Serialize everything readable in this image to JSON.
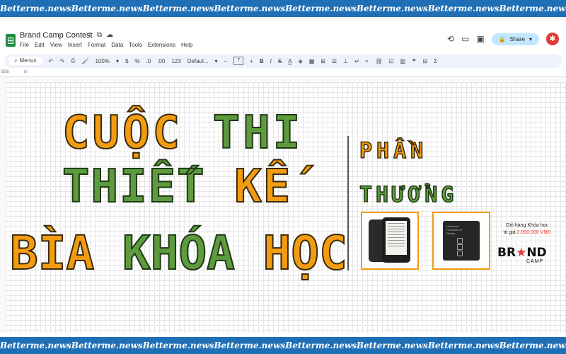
{
  "watermark": {
    "text": "Betterme.news",
    "repeat": 9,
    "band_color": "#1f6fb6"
  },
  "app": {
    "title": "Brand Camp Contest",
    "menu": [
      "File",
      "Edit",
      "View",
      "Insert",
      "Format",
      "Data",
      "Tools",
      "Extensions",
      "Help"
    ],
    "share_label": "Share",
    "toolbar": {
      "menus_label": "Menus",
      "zoom": "100%",
      "currency": "$",
      "percent": "%",
      "decimal_less": ".0",
      "decimal_more": ".00",
      "number_format": "123",
      "font": "Defaul...",
      "font_size": "7",
      "bold": "B",
      "italic": "I",
      "strike": "S",
      "text_color": "A"
    },
    "cell_ref": "B56",
    "fx": "fx"
  },
  "poster": {
    "line1": [
      "CUỘC",
      "THI"
    ],
    "line2": [
      "THIẾT",
      "KẾ"
    ],
    "line3": [
      "BÌA",
      "KHÓA",
      "HỌC"
    ],
    "prize_line1": "PHẦN",
    "prize_line2": "THƯỞNG",
    "course_text": "Giỏ hàng Khóa học",
    "course_value_prefix": "trị giá",
    "course_price": "2.000.000 VNĐ",
    "brand_left": "BR",
    "brand_star": "★",
    "brand_right": "ND",
    "brand_sub": "CAMP",
    "device_text": "Universal Principles of Design"
  },
  "colors": {
    "orange": "#f39c12",
    "green": "#5e9b3e",
    "accent_red": "#e53935"
  }
}
